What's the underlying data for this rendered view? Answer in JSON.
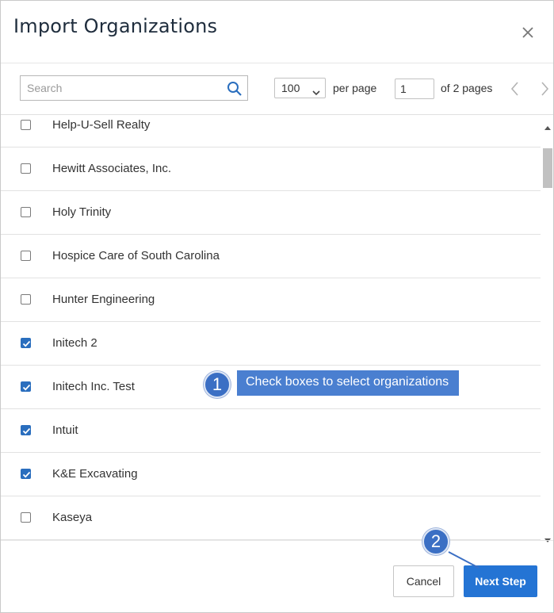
{
  "dialog": {
    "title": "Import Organizations"
  },
  "toolbar": {
    "search_placeholder": "Search",
    "per_page_value": "100",
    "per_page_label": "per page",
    "page_value": "1",
    "of_pages": "of 2 pages"
  },
  "organizations": [
    {
      "name": "Help-U-Sell Realty",
      "checked": false
    },
    {
      "name": "Hewitt Associates, Inc.",
      "checked": false
    },
    {
      "name": "Holy Trinity",
      "checked": false
    },
    {
      "name": "Hospice Care of South Carolina",
      "checked": false
    },
    {
      "name": "Hunter Engineering",
      "checked": false
    },
    {
      "name": "Initech 2",
      "checked": true
    },
    {
      "name": "Initech Inc. Test",
      "checked": true
    },
    {
      "name": "Intuit",
      "checked": true
    },
    {
      "name": "K&E Excavating",
      "checked": true
    },
    {
      "name": "Kaseya",
      "checked": false
    }
  ],
  "annotations": {
    "step1_number": "1",
    "step1_text": "Check boxes to select organizations",
    "step2_number": "2"
  },
  "footer": {
    "cancel_label": "Cancel",
    "next_label": "Next Step"
  },
  "colors": {
    "accent": "#2474d4",
    "checkbox": "#2a6ebe",
    "tooltip": "#4a7fd0",
    "badge": "#3b6fc4"
  },
  "icons": {
    "close": "close-icon",
    "search": "search-icon",
    "prev": "chevron-left-icon",
    "next": "chevron-right-icon"
  }
}
